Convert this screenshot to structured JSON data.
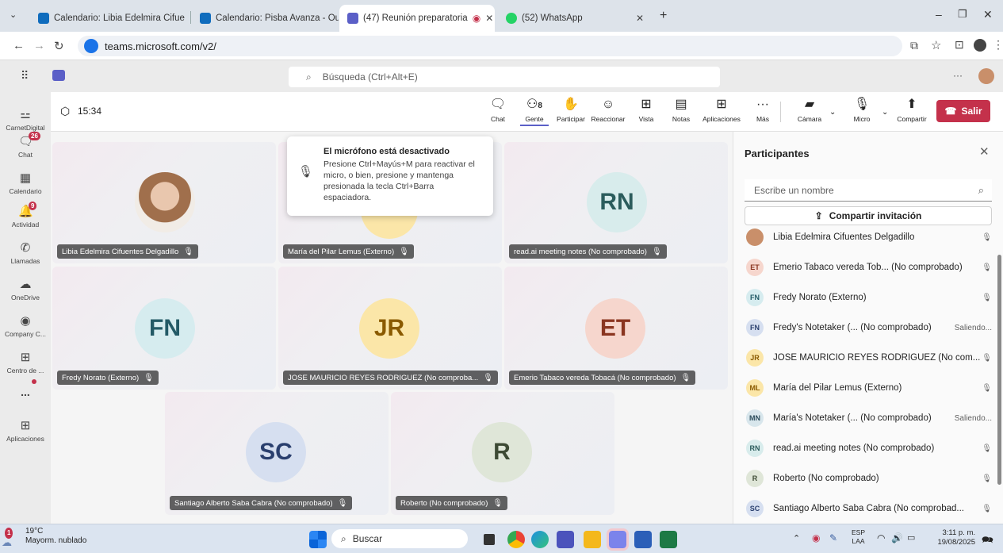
{
  "browser": {
    "tabs": [
      {
        "label": "Calendario: Libia Edelmira Cifue",
        "fav_color": "#0f6cbd"
      },
      {
        "label": "Calendario: Pisba Avanza - Out",
        "fav_color": "#0f6cbd"
      },
      {
        "label": "(47) Reunión preparatoria",
        "fav_color": "#5b5fc7"
      },
      {
        "label": "(52) WhatsApp",
        "fav_color": "#25d366"
      }
    ],
    "url": "teams.microsoft.com/v2/"
  },
  "teams_header": {
    "search_placeholder": "Búsqueda (Ctrl+Alt+E)"
  },
  "rail": {
    "items": [
      {
        "label": "CarnetDigital",
        "icon": "org-icon"
      },
      {
        "label": "Chat",
        "icon": "chat-icon",
        "badge": "26"
      },
      {
        "label": "Calendario",
        "icon": "calendar-icon"
      },
      {
        "label": "Actividad",
        "icon": "bell-icon",
        "badge": "9"
      },
      {
        "label": "Llamadas",
        "icon": "phone-icon"
      },
      {
        "label": "OneDrive",
        "icon": "cloud-icon"
      },
      {
        "label": "Company C...",
        "icon": "company-icon"
      },
      {
        "label": "Centro de ...",
        "icon": "apps-center-icon"
      },
      {
        "label": "...",
        "icon": "more-icon"
      },
      {
        "label": "Aplicaciones",
        "icon": "plus-icon"
      }
    ]
  },
  "meeting": {
    "timer": "15:34",
    "controls": [
      {
        "label": "Chat",
        "icon": "chat-icon"
      },
      {
        "label": "Gente",
        "icon": "people-icon",
        "count": "8"
      },
      {
        "label": "Participar",
        "icon": "raise-hand-icon"
      },
      {
        "label": "Reaccionar",
        "icon": "smiley-icon"
      },
      {
        "label": "Vista",
        "icon": "grid-icon"
      },
      {
        "label": "Notas",
        "icon": "notes-icon"
      },
      {
        "label": "Aplicaciones",
        "icon": "plus-icon"
      },
      {
        "label": "Más",
        "icon": "more-icon"
      },
      {
        "label": "Cámara",
        "icon": "camera-off-icon"
      },
      {
        "label": "Micro",
        "icon": "mic-off-icon"
      },
      {
        "label": "Compartir",
        "icon": "share-icon"
      }
    ],
    "leave_label": "Salir",
    "tiles": [
      {
        "name": "Libia Edelmira Cifuentes Delgadillo",
        "initials": "",
        "avatar_bg": "#f2dccc"
      },
      {
        "name": "María del Pilar Lemus (Externo)",
        "initials": "",
        "avatar_bg": "#fbe6a8"
      },
      {
        "name": "read.ai meeting notes (No comprobado)",
        "initials": "RN",
        "avatar_bg": "#d8ecec",
        "fg": "#2b5c5c"
      },
      {
        "name": "Fredy Norato (Externo)",
        "initials": "FN",
        "avatar_bg": "#d6ecef",
        "fg": "#235a66"
      },
      {
        "name": "JOSE MAURICIO REYES RODRIGUEZ (No comproba...",
        "initials": "JR",
        "avatar_bg": "#fbe6a8",
        "fg": "#8a5a00"
      },
      {
        "name": "Emerio Tabaco vereda Tobacá (No comprobado)",
        "initials": "ET",
        "avatar_bg": "#f6d6cd",
        "fg": "#8a3520"
      },
      {
        "name": "Santiago Alberto Saba Cabra (No comprobado)",
        "initials": "SC",
        "avatar_bg": "#d6dff0",
        "fg": "#2a3f6e"
      },
      {
        "name": "Roberto (No comprobado)",
        "initials": "R",
        "avatar_bg": "#dfe6d8",
        "fg": "#3d4a34"
      }
    ],
    "toast": {
      "title": "El micrófono está desactivado",
      "body": "Presione Ctrl+Mayús+M para reactivar el micro, o bien, presione y mantenga presionada la tecla Ctrl+Barra espaciadora."
    }
  },
  "participants": {
    "title": "Participantes",
    "search_placeholder": "Escribe un nombre",
    "invite_label": "Compartir invitación",
    "list": [
      {
        "initials": "",
        "name": "Libia Edelmira Cifuentes Delgadillo",
        "status": "",
        "bg": "#f2dccc",
        "fg": "#6b3a20"
      },
      {
        "initials": "ET",
        "name": "Emerio Tabaco vereda Tob... (No comprobado)",
        "status": "",
        "bg": "#f6d6cd",
        "fg": "#8a3520"
      },
      {
        "initials": "FN",
        "name": "Fredy Norato (Externo)",
        "status": "",
        "bg": "#d6ecef",
        "fg": "#235a66"
      },
      {
        "initials": "FN",
        "name": "Fredy's Notetaker (... (No comprobado)",
        "status": "Saliendo...",
        "bg": "#d6dff0",
        "fg": "#2a3f6e"
      },
      {
        "initials": "JR",
        "name": "JOSE MAURICIO REYES RODRIGUEZ (No com...",
        "status": "",
        "bg": "#fbe6a8",
        "fg": "#8a5a00"
      },
      {
        "initials": "ML",
        "name": "María del Pilar Lemus (Externo)",
        "status": "",
        "bg": "#fbe6a8",
        "fg": "#8a5a00"
      },
      {
        "initials": "MN",
        "name": "María's Notetaker (... (No comprobado)",
        "status": "Saliendo...",
        "bg": "#d8e6ec",
        "fg": "#2b4c5c"
      },
      {
        "initials": "RN",
        "name": "read.ai meeting notes (No comprobado)",
        "status": "",
        "bg": "#d8ecec",
        "fg": "#2b5c5c"
      },
      {
        "initials": "R",
        "name": "Roberto (No comprobado)",
        "status": "",
        "bg": "#dfe6d8",
        "fg": "#3d4a34"
      },
      {
        "initials": "SC",
        "name": "Santiago Alberto Saba Cabra (No comprobad...",
        "status": "",
        "bg": "#d6dff0",
        "fg": "#2a3f6e"
      }
    ]
  },
  "taskbar": {
    "weather_temp": "19°C",
    "weather_desc": "Mayorm. nublado",
    "weather_badge": "1",
    "search_label": "Buscar",
    "lang": "ESP",
    "lang_sub": "LAA",
    "time": "3:11 p. m.",
    "date": "19/08/2025"
  },
  "colors": {
    "accent": "#5b5fc7",
    "leave": "#c4314b"
  }
}
